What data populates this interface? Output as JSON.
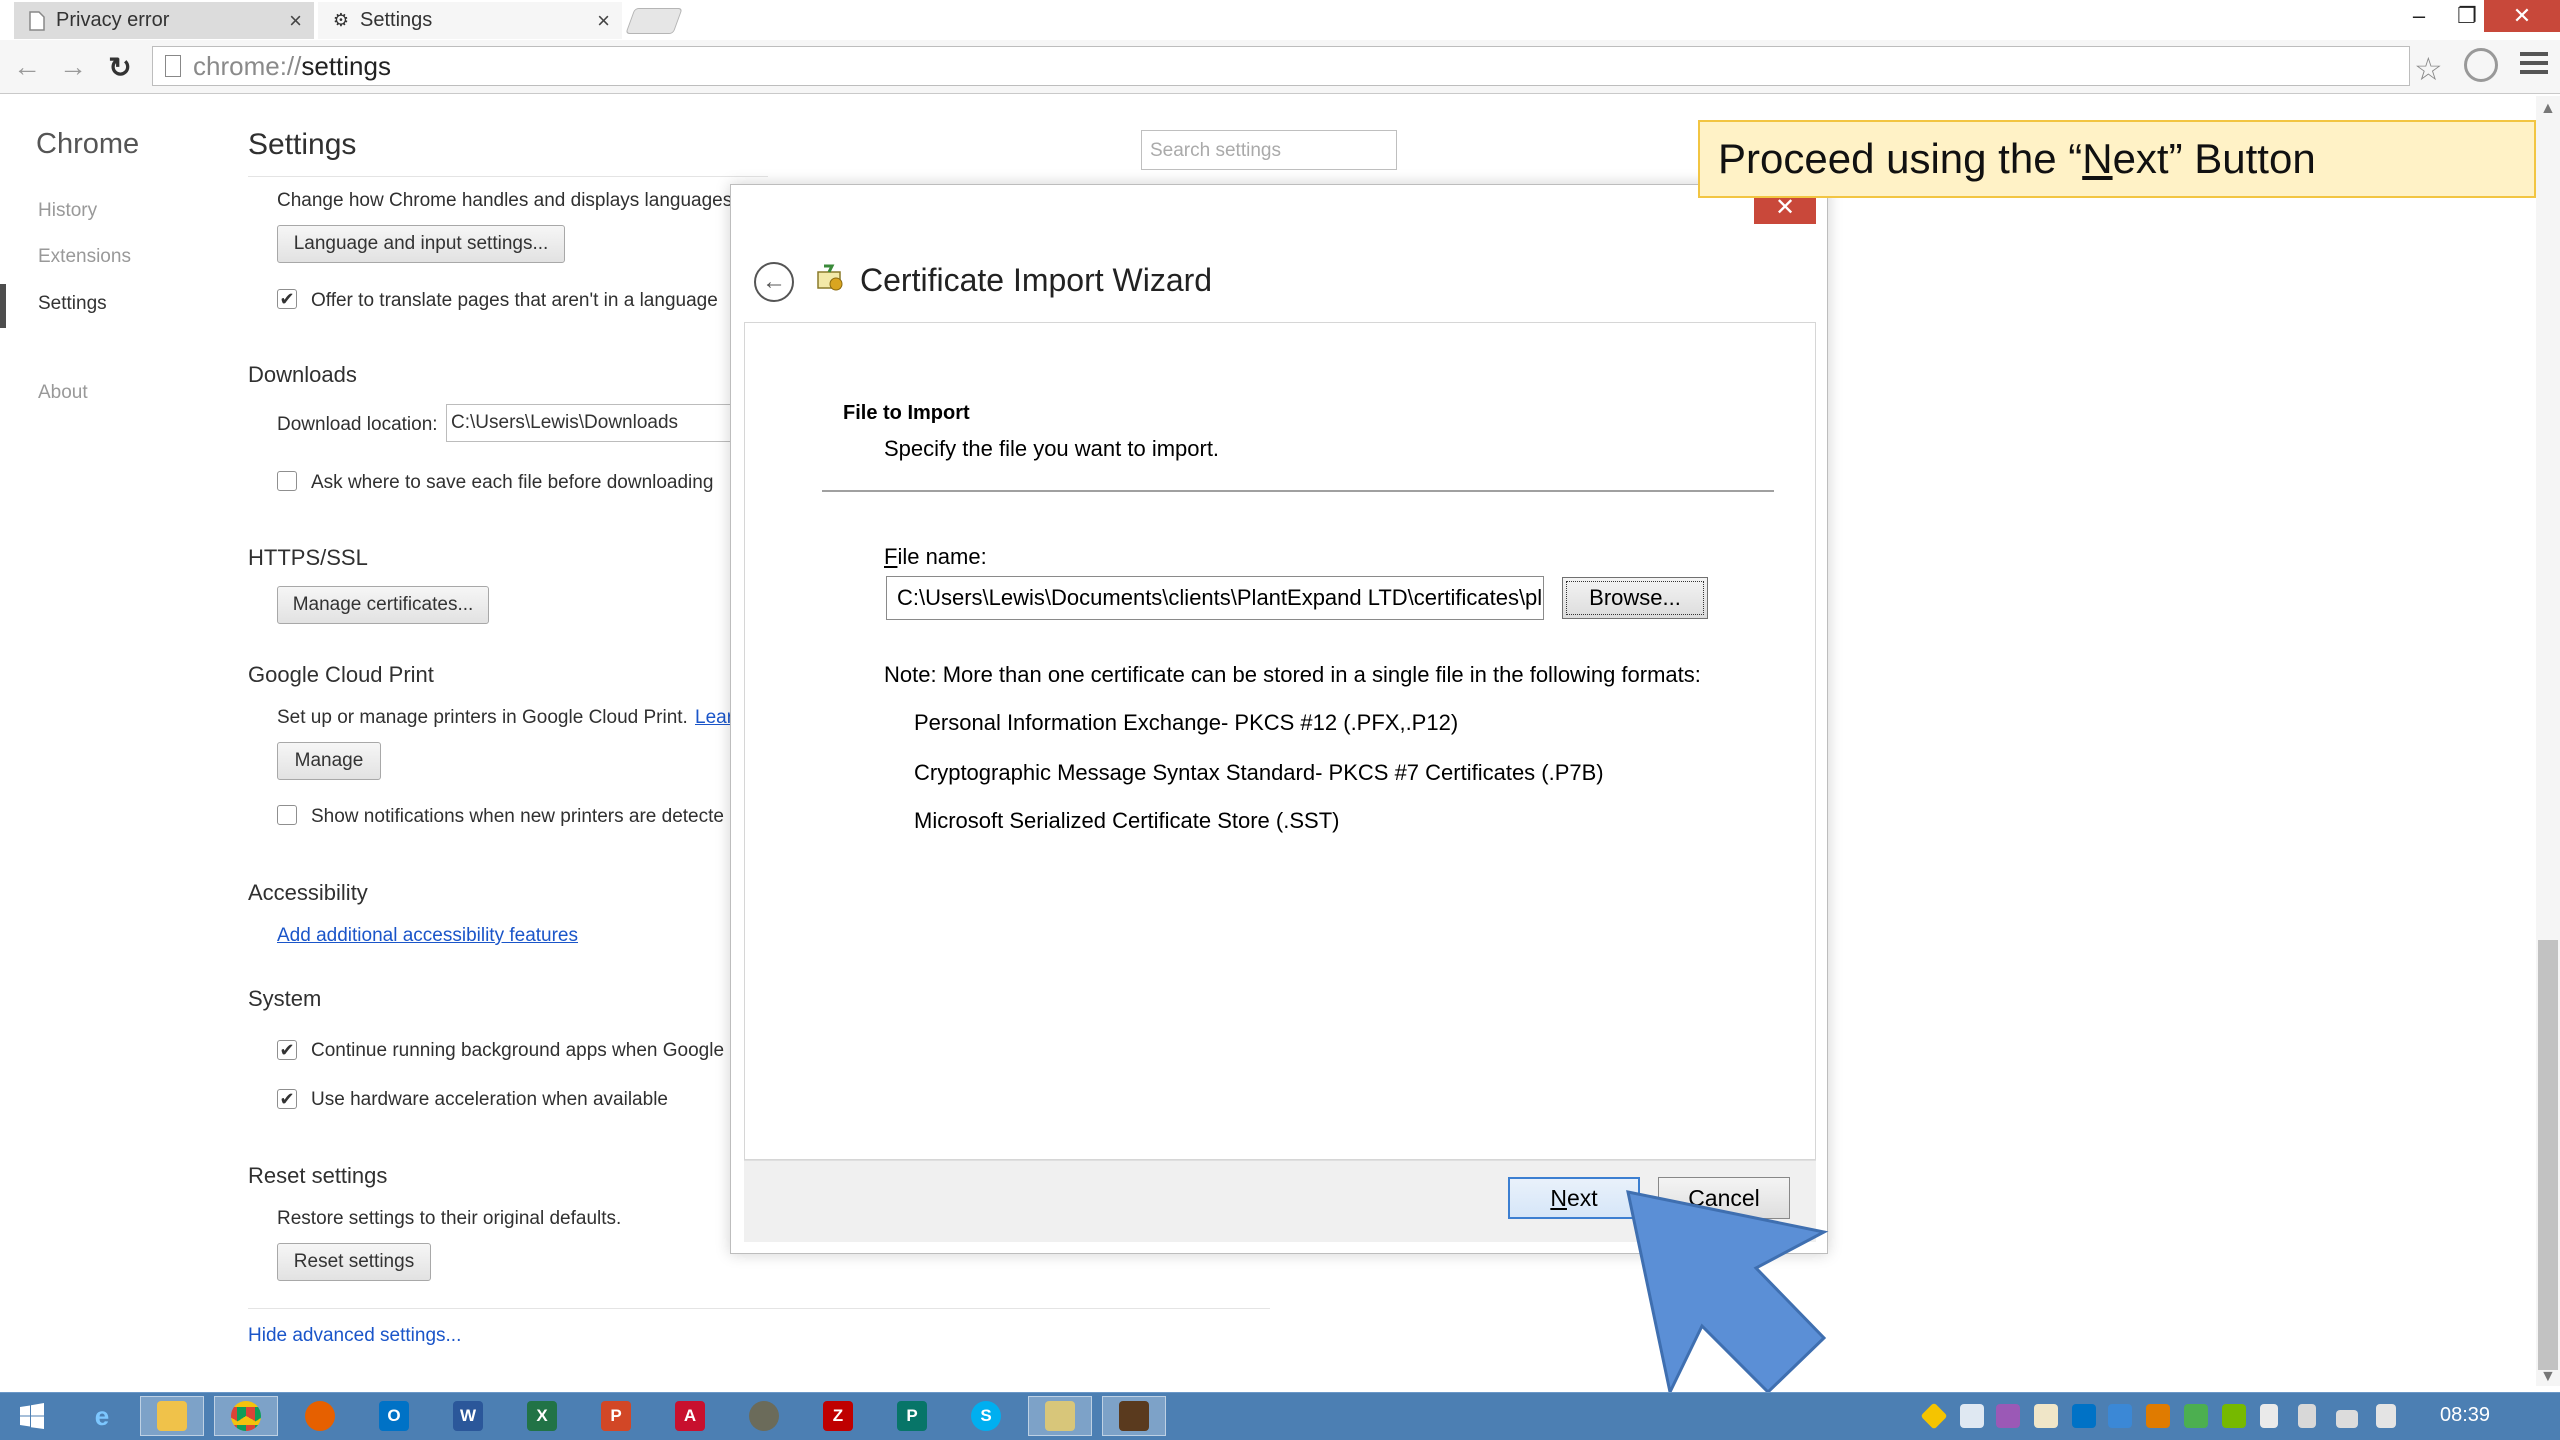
{
  "browser": {
    "tabs": [
      {
        "label": "Privacy error",
        "active": false
      },
      {
        "label": "Settings",
        "active": true
      }
    ],
    "url_scheme": "chrome://",
    "url_host": "settings",
    "window_buttons": {
      "minimize": "–",
      "restore": "❐",
      "close": "✕"
    }
  },
  "settings": {
    "brand": "Chrome",
    "sidebar": [
      {
        "label": "History"
      },
      {
        "label": "Extensions"
      },
      {
        "label": "Settings",
        "active": true
      },
      {
        "label": "About"
      }
    ],
    "title": "Settings",
    "search_placeholder": "Search settings",
    "languages": {
      "desc": "Change how Chrome handles and displays languages.",
      "button": "Language and input settings...",
      "translate_label": "Offer to translate pages that aren't in a language",
      "translate_checked": true
    },
    "downloads": {
      "heading": "Downloads",
      "location_label": "Download location:",
      "location_value": "C:\\Users\\Lewis\\Downloads",
      "ask_label": "Ask where to save each file before downloading",
      "ask_checked": false
    },
    "https": {
      "heading": "HTTPS/SSL",
      "button": "Manage certificates..."
    },
    "cloud_print": {
      "heading": "Google Cloud Print",
      "desc": "Set up or manage printers in Google Cloud Print.",
      "learn": "Lear",
      "button": "Manage",
      "notify_label": "Show notifications when new printers are detecte",
      "notify_checked": false
    },
    "accessibility": {
      "heading": "Accessibility",
      "link": "Add additional accessibility features"
    },
    "system": {
      "heading": "System",
      "bg_apps_label": "Continue running background apps when Google",
      "bg_apps_checked": true,
      "hw_accel_label": "Use hardware acceleration when available",
      "hw_accel_checked": true
    },
    "reset": {
      "heading": "Reset settings",
      "desc": "Restore settings to their original defaults.",
      "button": "Reset settings"
    },
    "hide_advanced": "Hide advanced settings..."
  },
  "wizard": {
    "title": "Certificate Import Wizard",
    "step_title": "File to Import",
    "step_desc": "Specify the file you want to import.",
    "file_label": "File name:",
    "file_value": "C:\\Users\\Lewis\\Documents\\clients\\PlantExpand LTD\\certificates\\pla",
    "browse": "Browse...",
    "note": "Note:  More than one certificate can be stored in a single file in the following formats:",
    "formats": [
      "Personal Information Exchange- PKCS #12 (.PFX,.P12)",
      "Cryptographic Message Syntax Standard- PKCS #7 Certificates (.P7B)",
      "Microsoft Serialized Certificate Store (.SST)"
    ],
    "next": "Next",
    "cancel": "Cancel",
    "close": "✕"
  },
  "callout": {
    "prefix": "Proceed using the “",
    "key": "N",
    "rest": "ext” Button"
  },
  "taskbar": {
    "apps": [
      {
        "name": "start",
        "icon": "windows-icon"
      },
      {
        "name": "ie",
        "icon": "internet-explorer-icon"
      },
      {
        "name": "explorer",
        "icon": "file-explorer-icon"
      },
      {
        "name": "chrome",
        "icon": "chrome-icon"
      },
      {
        "name": "firefox",
        "icon": "firefox-icon"
      },
      {
        "name": "outlook",
        "icon": "outlook-icon",
        "glyph": "O"
      },
      {
        "name": "word",
        "icon": "word-icon",
        "glyph": "W"
      },
      {
        "name": "excel",
        "icon": "excel-icon",
        "glyph": "X"
      },
      {
        "name": "powerpoint",
        "icon": "powerpoint-icon",
        "glyph": "P"
      },
      {
        "name": "acrobat",
        "icon": "acrobat-icon",
        "glyph": "A"
      },
      {
        "name": "gimp",
        "icon": "gimp-icon"
      },
      {
        "name": "filezilla",
        "icon": "filezilla-icon",
        "glyph": "Z"
      },
      {
        "name": "publisher",
        "icon": "publisher-icon",
        "glyph": "P"
      },
      {
        "name": "skype",
        "icon": "skype-icon",
        "glyph": "S"
      },
      {
        "name": "certmgr",
        "icon": "certificate-wizard-icon"
      },
      {
        "name": "media",
        "icon": "media-app-icon"
      }
    ],
    "clock": "08:39"
  },
  "colors": {
    "accent_blue": "#3c7fd1",
    "dialog_close_red": "#c9483a",
    "taskbar": "#4c7fb3",
    "callout_fill": "#fff2c6",
    "callout_border": "#f2c542",
    "arrow_fill": "#5b8fd6"
  }
}
